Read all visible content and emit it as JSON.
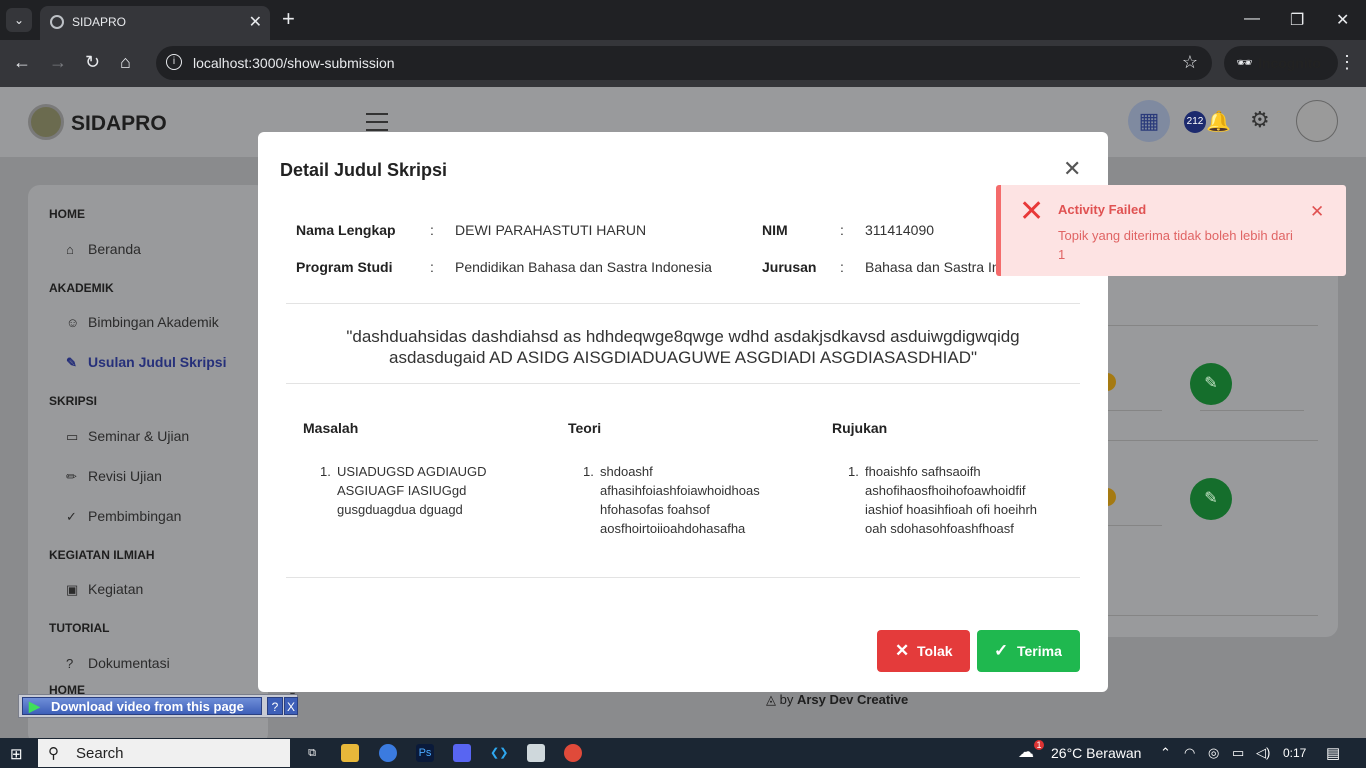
{
  "browser": {
    "tab_title": "SIDAPRO",
    "url": "localhost:3000/show-submission",
    "incognito_label": "Incognito"
  },
  "app": {
    "brand": "SIDAPRO",
    "notif_count": "212"
  },
  "sidebar": {
    "sections": [
      {
        "title": "HOME",
        "items": [
          {
            "label": "Beranda",
            "icon": "home-icon"
          }
        ]
      },
      {
        "title": "AKADEMIK",
        "items": [
          {
            "label": "Bimbingan Akademik",
            "icon": "users-icon"
          },
          {
            "label": "Usulan Judul Skripsi",
            "icon": "user-edit-icon",
            "active": true
          }
        ]
      },
      {
        "title": "SKRIPSI",
        "items": [
          {
            "label": "Seminar & Ujian",
            "icon": "monitor-icon"
          },
          {
            "label": "Revisi Ujian",
            "icon": "pencil-icon"
          },
          {
            "label": "Pembimbingan",
            "icon": "check-icon"
          }
        ]
      },
      {
        "title": "KEGIATAN ILMIAH",
        "items": [
          {
            "label": "Kegiatan",
            "icon": "briefcase-icon"
          }
        ]
      },
      {
        "title": "TUTORIAL",
        "items": [
          {
            "label": "Dokumentasi",
            "icon": "question-icon"
          }
        ]
      },
      {
        "title": "HOME",
        "items": []
      }
    ]
  },
  "footer": {
    "by": "by",
    "credit": "Arsy Dev Creative"
  },
  "download_bar": {
    "label": "Download video from this page",
    "help": "?",
    "close": "X"
  },
  "modal": {
    "title": "Detail Judul Skripsi",
    "fields": {
      "nama_label": "Nama Lengkap",
      "nama_value": "DEWI PARAHASTUTI HARUN",
      "nim_label": "NIM",
      "nim_value": "311414090",
      "prodi_label": "Program Studi",
      "prodi_value": "Pendidikan Bahasa dan Sastra Indonesia",
      "jurusan_label": "Jurusan",
      "jurusan_value": "Bahasa dan Sastra Indonesia",
      "sep": ":"
    },
    "quote_line1": "\"dashduahsidas dashdiahsd as hdhdeqwge8qwge wdhd asdakjsdkavsd asduiwgdigwqidg",
    "quote_line2": "asdasdugaid AD ASIDG AISGDIADUAGUWE ASGDIADI ASGDIASASDHIAD\"",
    "columns": [
      {
        "title": "Masalah",
        "items": [
          "USIADUGSD AGDIAUGD ASGIUAGF IASIUGgd gusgduagdua dguagd"
        ]
      },
      {
        "title": "Teori",
        "items": [
          "shdoashf afhasihfoiashfoiawhoidhoas hfohasofas foahsof aosfhoirtoiioahdohasafha"
        ]
      },
      {
        "title": "Rujukan",
        "items": [
          "fhoaishfo safhsaoifh ashofihaosfhoihofoawhoidfif iashiof hoasihfioah ofi hoeihrh oah sdohasohfoashfhoasf"
        ]
      }
    ],
    "btn_reject": "Tolak",
    "btn_accept": "Terima"
  },
  "toast": {
    "title": "Activity Failed",
    "message": "Topik yang diterima tidak boleh lebih dari 1"
  },
  "taskbar": {
    "search": "Search",
    "weather": "26°C  Berawan",
    "weather_badge": "1",
    "time": "0:17"
  },
  "colors": {
    "accent": "#26307a",
    "reject": "#e43b3b",
    "accept": "#1fb84f",
    "toast_bg": "#fde3e3",
    "toast_fg": "#e05252"
  }
}
